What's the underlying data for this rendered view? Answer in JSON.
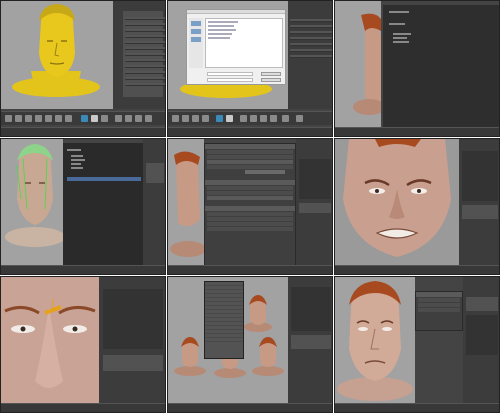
{
  "title": "",
  "panels": [
    {
      "id": "p1",
      "label": ""
    },
    {
      "id": "p2",
      "label": ""
    },
    {
      "id": "p3",
      "label": ""
    },
    {
      "id": "p4",
      "label": ""
    },
    {
      "id": "p5",
      "label": ""
    },
    {
      "id": "p6",
      "label": ""
    },
    {
      "id": "p7",
      "label": ""
    },
    {
      "id": "p8",
      "label": ""
    },
    {
      "id": "p9",
      "label": ""
    }
  ],
  "colors": {
    "viewport_bg": "#a2a2a2",
    "ui_dark": "#3c3c3c",
    "head_yellow": "#e3c41a",
    "skin": "#c79a86",
    "hair": "#a84a20"
  },
  "icons": [
    "save-icon",
    "folder-icon",
    "close-icon",
    "menu-icon"
  ]
}
